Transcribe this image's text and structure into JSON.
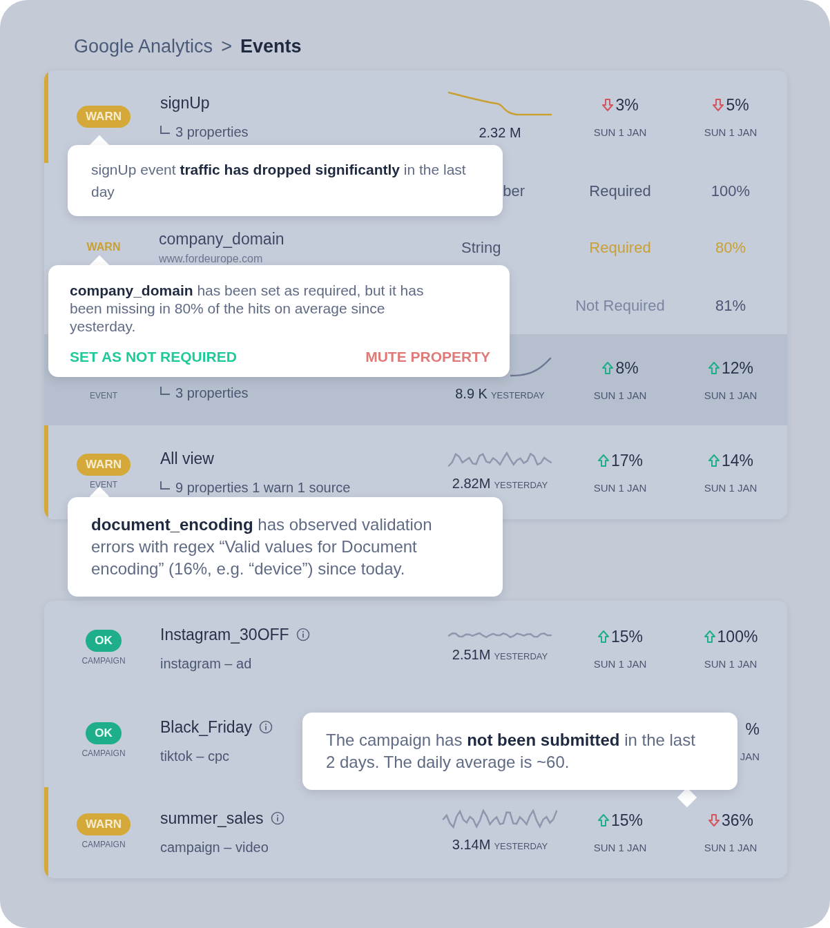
{
  "breadcrumb": {
    "parent": "Google Analytics",
    "separator": ">",
    "current": "Events"
  },
  "events_card": {
    "rows": [
      {
        "kind": "event",
        "badge": {
          "label": "WARN",
          "ok": false
        },
        "flagged": true,
        "highlighted": false,
        "name": "signUp",
        "detail": "3 properties",
        "total": "2.32 M",
        "metrics": [
          {
            "value": "3%",
            "rising": false,
            "date": "SUN 1 JAN"
          },
          {
            "value": "5%",
            "rising": false,
            "date": "SUN 1 JAN"
          }
        ]
      },
      {
        "kind": "property",
        "type": "ber",
        "type_cut": true,
        "requirement": "Required",
        "required": true,
        "share": "100%",
        "warn": false
      },
      {
        "kind": "property",
        "flag": "WARN",
        "name": "company_domain",
        "source": "www.fordeurope.com",
        "type": "String",
        "requirement": "Required",
        "required": true,
        "share": "80%",
        "warn": true
      },
      {
        "kind": "property",
        "requirement": "Not Required",
        "required": false,
        "share": "81%",
        "warn": false
      },
      {
        "kind": "event",
        "type_label": "EVENT",
        "flagged": false,
        "highlighted": true,
        "detail": "3 properties",
        "total": "8.9 K",
        "total_suffix": "YESTERDAY",
        "metrics": [
          {
            "value": "8%",
            "rising": true,
            "date": "SUN 1 JAN"
          },
          {
            "value": "12%",
            "rising": true,
            "date": "SUN 1 JAN"
          }
        ]
      },
      {
        "kind": "event",
        "badge": {
          "label": "WARN",
          "ok": false
        },
        "type_label": "EVENT",
        "flagged": true,
        "highlighted": false,
        "name": "All view",
        "detail": "9 properties 1 warn 1 source",
        "total": "2.82M",
        "total_suffix": "YESTERDAY",
        "metrics": [
          {
            "value": "17%",
            "rising": true,
            "date": "SUN 1 JAN"
          },
          {
            "value": "14%",
            "rising": true,
            "date": "SUN 1 JAN"
          }
        ]
      }
    ]
  },
  "campaigns_card": {
    "rows": [
      {
        "badge": {
          "label": "OK",
          "ok": true
        },
        "type_label": "CAMPAIGN",
        "flagged": false,
        "name": "Instagram_30OFF",
        "detail": "instagram – ad",
        "total": "2.51M",
        "total_suffix": "YESTERDAY",
        "metrics": [
          {
            "value": "15%",
            "rising": true,
            "date": "SUN 1 JAN"
          },
          {
            "value": "100%",
            "rising": true,
            "date": "SUN 1 JAN"
          }
        ]
      },
      {
        "badge": {
          "label": "OK",
          "ok": true
        },
        "type_label": "CAMPAIGN",
        "flagged": false,
        "name": "Black_Friday",
        "detail": "tiktok – cpc",
        "metrics": [
          {
            "value": "%",
            "date": "JAN",
            "cut": true
          }
        ]
      },
      {
        "badge": {
          "label": "WARN",
          "ok": false
        },
        "type_label": "CAMPAIGN",
        "flagged": true,
        "name": "summer_sales",
        "detail": "campaign – video",
        "total": "3.14M",
        "total_suffix": "YESTERDAY",
        "metrics": [
          {
            "value": "15%",
            "rising": true,
            "date": "SUN 1 JAN"
          },
          {
            "value": "36%",
            "rising": false,
            "date": "SUN 1 JAN"
          }
        ]
      }
    ]
  },
  "tooltips": [
    {
      "text": "signUp event **traffic has dropped significantly** in the last day"
    },
    {
      "text": "**company_domain** has been set as required, but it has been missing in 80% of the hits on average since yesterday.",
      "actions": [
        {
          "label": "SET AS NOT REQUIRED",
          "destructive": false
        },
        {
          "label": "MUTE PROPERTY",
          "destructive": true
        }
      ]
    },
    {
      "text": "**document_encoding** has observed validation errors with regex “Valid values for Document encoding” (16%, e.g. “device”) since today."
    },
    {
      "text": "The campaign has **not been submitted** in the last 2 days. The daily average is ~60."
    }
  ]
}
